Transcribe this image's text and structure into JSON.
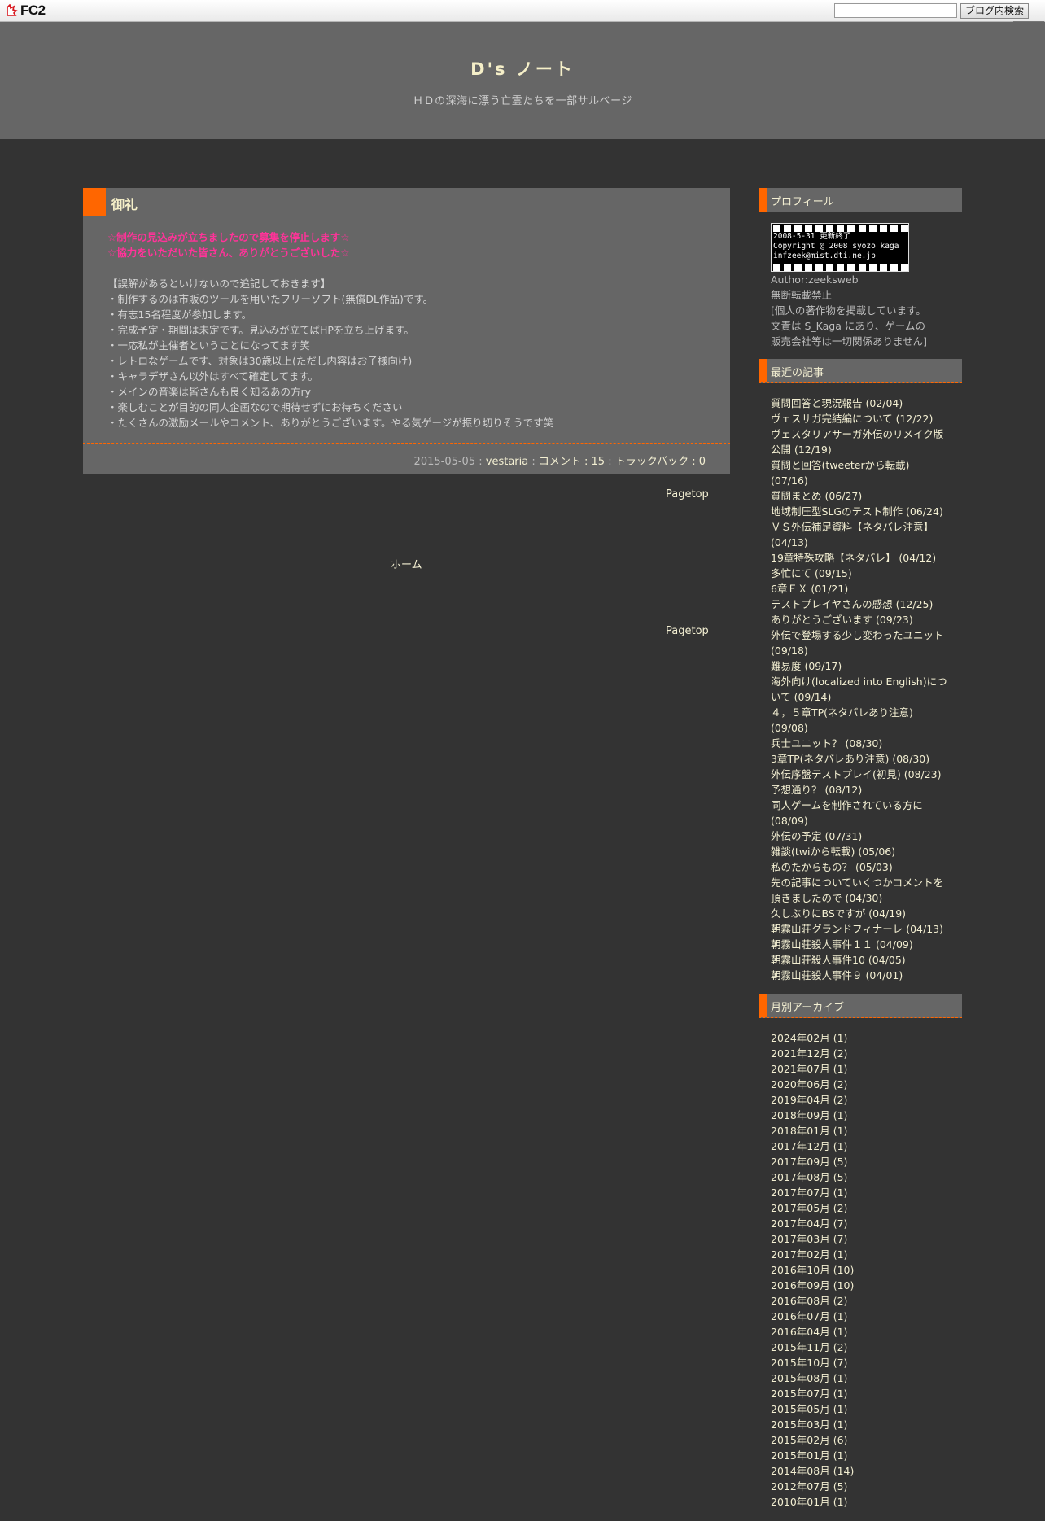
{
  "fc2bar": {
    "logo_text": "FC2",
    "search_value": "",
    "search_button": "ブログ内検索"
  },
  "header": {
    "title": "D's ノート",
    "description": "ＨＤの深海に漂う亡霊たちを一部サルベージ"
  },
  "entry": {
    "title": "御礼",
    "notice_lines": [
      "☆制作の見込みが立ちましたので募集を停止します☆",
      "☆協力をいただいた皆さん、ありがとうございした☆"
    ],
    "body_lines": [
      "【誤解があるといけないので追記しておきます】",
      "・制作するのは市販のツールを用いたフリーソフト(無償DL作品)です。",
      "・有志15名程度が参加します。",
      "・完成予定・期間は未定です。見込みが立てばHPを立ち上げます。",
      "・一応私が主催者ということになってます笑",
      "・レトロなゲームです、対象は30歳以上(ただし内容はお子様向け)",
      "・キャラデザさん以外はすべて確定してます。",
      "・メインの音楽は皆さんも良く知るあの方ry",
      "・楽しむことが目的の同人企画なので期待せずにお待ちください",
      "・たくさんの激励メールやコメント、ありがとうございます。やる気ゲージが振り切りそうです笑"
    ],
    "date": "2015-05-05",
    "author": "vestaria",
    "comments": "コメント : 15",
    "trackbacks": "トラックバック : 0",
    "sep": " : "
  },
  "nav": {
    "pagetop": "Pagetop",
    "home": "ホーム"
  },
  "sidebar": {
    "profile": {
      "heading": "プロフィール",
      "image_lines": [
        "2008-5-31 更新終了",
        "Copyright @ 2008 syozo kaga",
        "infzeek@mist.dti.ne.jp"
      ],
      "author": "Author:zeeksweb",
      "lines": [
        "無断転載禁止",
        "[個人の著作物を掲載しています。",
        "文責は S_Kaga にあり、ゲームの",
        "販売会社等は一切関係ありません]"
      ]
    },
    "recent": {
      "heading": "最近の記事",
      "items": [
        "質問回答と現況報告 (02/04)",
        "ヴェスサガ完結編について (12/22)",
        "ヴェスタリアサーガ外伝のリメイク版公開 (12/19)",
        "質問と回答(tweeterから転載) (07/16)",
        "質問まとめ (06/27)",
        "地域制圧型SLGのテスト制作 (06/24)",
        "ＶＳ外伝補足資料【ネタバレ注意】(04/13)",
        "19章特殊攻略【ネタバレ】 (04/12)",
        "多忙にて (09/15)",
        "6章ＥＸ (01/21)",
        "テストプレイヤさんの感想 (12/25)",
        "ありがとうございます (09/23)",
        "外伝で登場する少し変わったユニット (09/18)",
        "難易度 (09/17)",
        "海外向け(localized into English)について (09/14)",
        "４，５章TP(ネタバレあり注意) (09/08)",
        "兵士ユニット？ (08/30)",
        "3章TP(ネタバレあり注意) (08/30)",
        "外伝序盤テストプレイ(初見) (08/23)",
        "予想通り？ (08/12)",
        "同人ゲームを制作されている方に (08/09)",
        "外伝の予定 (07/31)",
        "雑談(twiから転載) (05/06)",
        "私のたからもの？ (05/03)",
        "先の記事についていくつかコメントを頂きましたので (04/30)",
        "久しぶりにBSですが (04/19)",
        "朝霧山荘グランドフィナーレ (04/13)",
        "朝霧山荘殺人事件１１ (04/09)",
        "朝霧山荘殺人事件10 (04/05)",
        "朝霧山荘殺人事件９ (04/01)"
      ]
    },
    "archive": {
      "heading": "月別アーカイブ",
      "items": [
        "2024年02月 (1)",
        "2021年12月 (2)",
        "2021年07月 (1)",
        "2020年06月 (2)",
        "2019年04月 (2)",
        "2018年09月 (1)",
        "2018年01月 (1)",
        "2017年12月 (1)",
        "2017年09月 (5)",
        "2017年08月 (5)",
        "2017年07月 (1)",
        "2017年05月 (2)",
        "2017年04月 (7)",
        "2017年03月 (7)",
        "2017年02月 (1)",
        "2016年10月 (10)",
        "2016年09月 (10)",
        "2016年08月 (2)",
        "2016年07月 (1)",
        "2016年04月 (1)",
        "2015年11月 (2)",
        "2015年10月 (7)",
        "2015年08月 (1)",
        "2015年07月 (1)",
        "2015年05月 (1)",
        "2015年03月 (1)",
        "2015年02月 (6)",
        "2015年01月 (1)",
        "2014年08月 (14)",
        "2012年07月 (5)",
        "2010年01月 (1)"
      ]
    }
  },
  "colors": {
    "accent": "#ff6600",
    "page_bg": "#333333",
    "panel_bg": "#666666",
    "link": "#f3efd2",
    "notice": "#ff3399"
  }
}
